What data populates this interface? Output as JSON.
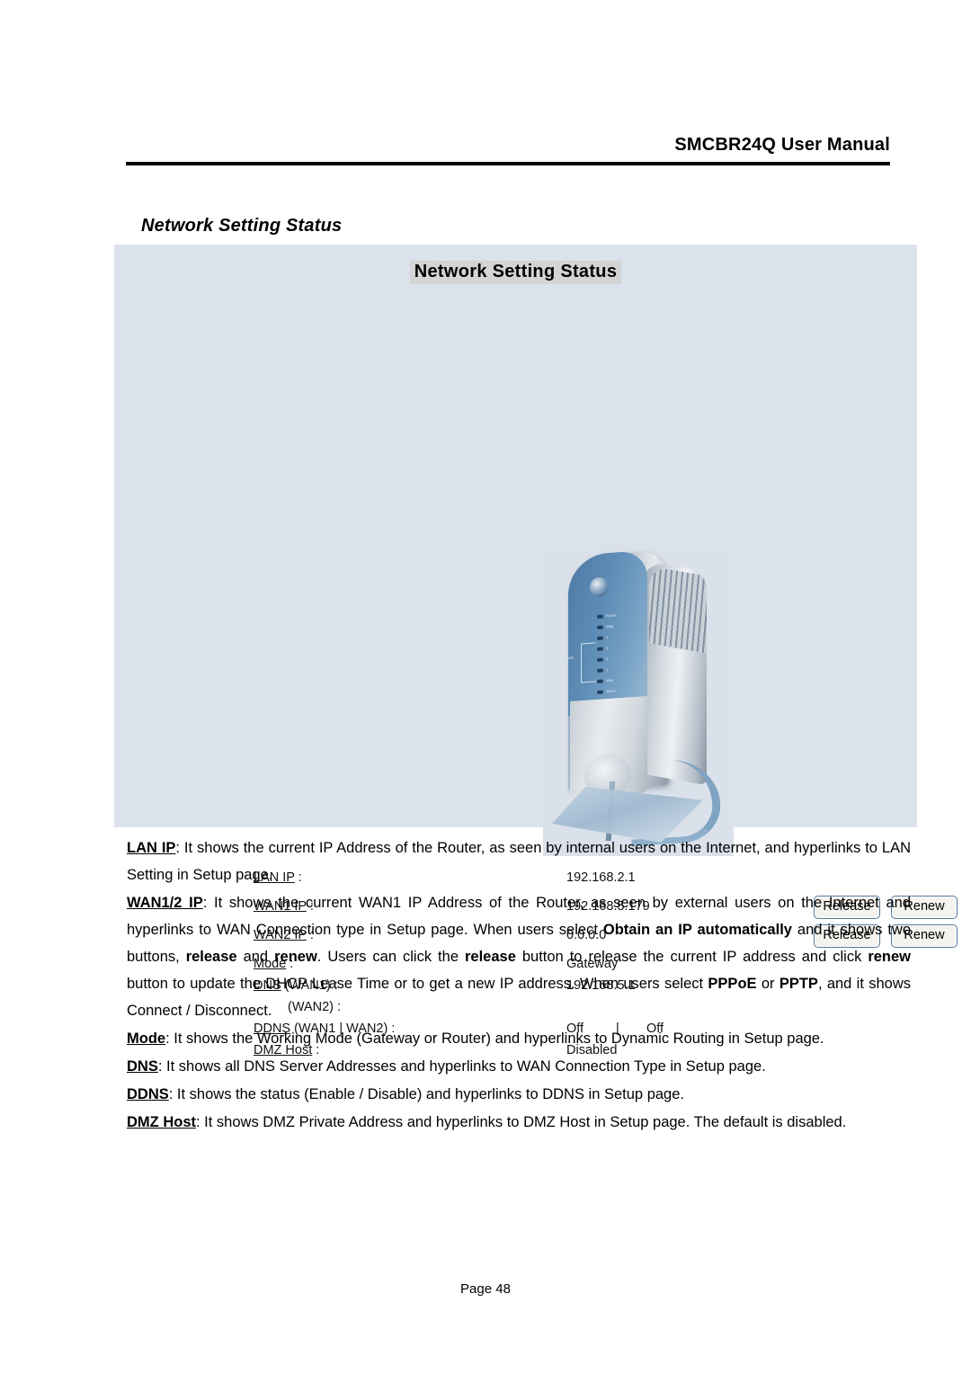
{
  "document": {
    "header_title": "SMCBR24Q User Manual",
    "section_heading": "Network Setting Status",
    "footer": "Page 48"
  },
  "panel": {
    "title": "Network Setting Status",
    "device_image": {
      "alt": "router-product-photo",
      "leds": [
        {
          "label": "Power"
        },
        {
          "label": "Diag"
        },
        {
          "label": "4"
        },
        {
          "label": "3"
        },
        {
          "label": "2"
        },
        {
          "label": "1"
        },
        {
          "label": "Wan"
        },
        {
          "label": "Wan2"
        }
      ],
      "lan_bracket_label": "LAN"
    },
    "fields": [
      {
        "label": "LAN IP",
        "link_text": "LAN IP",
        "suffix": " :",
        "value": "192.168.2.1",
        "buttons": []
      },
      {
        "label": "WAN1 IP",
        "link_text": "WAN1 IP",
        "suffix": " :",
        "value": "192.168.5.179",
        "buttons": [
          "Release",
          "Renew"
        ]
      },
      {
        "label": "WAN2 IP",
        "link_text": "WAN2 IP",
        "suffix": " :",
        "value": "0.0.0.0",
        "buttons": [
          "Release",
          "Renew"
        ]
      },
      {
        "label": "Mode",
        "link_text": "Mode",
        "suffix": " :",
        "value": "Gateway",
        "buttons": []
      },
      {
        "label": "DNS (WAN1)",
        "link_text": "DNS",
        "suffix": " (WAN1) :",
        "value": "192.168.5.1",
        "buttons": []
      },
      {
        "label": "(WAN2)",
        "link_text": "",
        "suffix": "(WAN2) :",
        "value": "",
        "buttons": []
      },
      {
        "label": "DDNS (WAN1 | WAN2)",
        "link_text": "DDNS",
        "suffix": " (WAN1  |  WAN2) :",
        "value": "Off",
        "value2": "Off",
        "separator": "|",
        "buttons": []
      },
      {
        "label": "DMZ Host",
        "link_text": "DMZ Host",
        "suffix": " :",
        "value": "Disabled",
        "buttons": []
      }
    ],
    "buttons": {
      "release": "Release",
      "renew": "Renew"
    }
  },
  "descriptions": {
    "lan_ip": {
      "term": "LAN IP",
      "text_1": ": It shows the current IP Address of the Router, as seen by internal users on the Internet, and hyperlinks to LAN Setting in Setup page."
    },
    "wan_ip": {
      "term": "WAN1/2 IP",
      "text_1": ": It shows the current WAN1 IP Address of the Router, as seen by external users on the Internet and hyperlinks to WAN Connection type in Setup page. When users select ",
      "bold_1": "Obtain an IP automatically",
      "text_2": " and it shows two buttons, ",
      "bold_2": "release",
      "text_3": " and ",
      "bold_3": "renew",
      "text_4": ". Users can click the ",
      "bold_4": "release",
      "text_5": " button to release the current IP address and click ",
      "bold_5": "renew",
      "text_6": " button to update the DHCP Lease Time or to get a new IP address. When users select ",
      "bold_6": "PPPoE",
      "text_7": " or ",
      "bold_7": "PPTP",
      "text_8": ", and it shows Connect / Disconnect."
    },
    "mode": {
      "term": "Mode",
      "text_1": ": It shows the Working Mode (Gateway or Router) and hyperlinks to Dynamic Routing in Setup page."
    },
    "dns": {
      "term": "DNS",
      "text_1": ": It shows all DNS Server Addresses and hyperlinks to WAN Connection Type in Setup page."
    },
    "ddns": {
      "term": "DDNS",
      "text_1": ": It shows the status (Enable / Disable) and hyperlinks to DDNS in Setup page."
    },
    "dmz_host": {
      "term": "DMZ Host",
      "text_1": ": It shows DMZ Private Address and hyperlinks to DMZ Host in Setup page. The default is disabled."
    }
  }
}
